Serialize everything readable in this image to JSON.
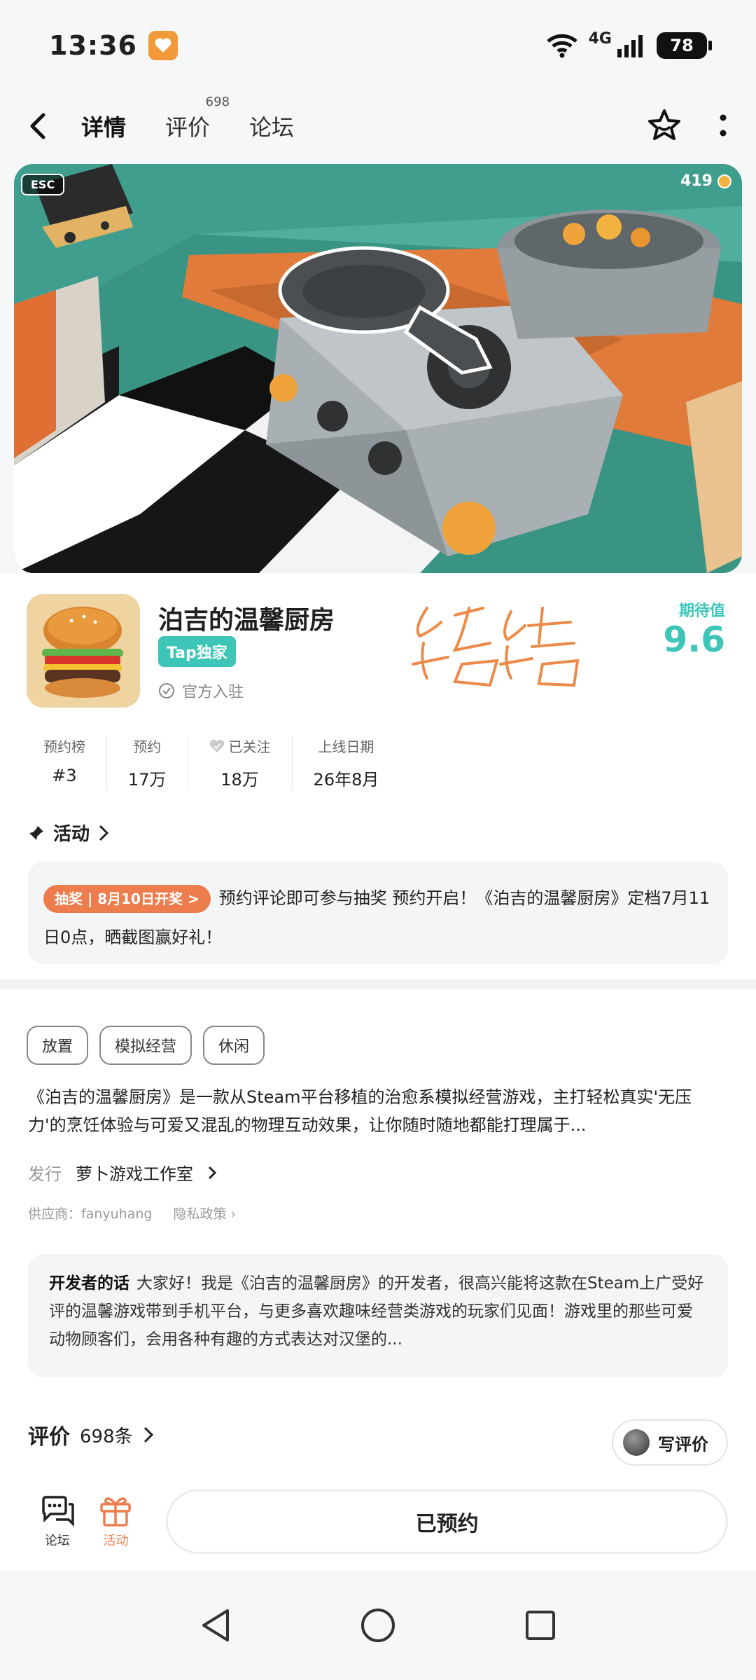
{
  "status": {
    "time": "13:36",
    "network": "4G",
    "battery": "78"
  },
  "nav": {
    "tabs": [
      {
        "label": "详情"
      },
      {
        "label": "评价",
        "count": "698"
      },
      {
        "label": "论坛"
      }
    ]
  },
  "hero": {
    "esc": "ESC",
    "counter": "419"
  },
  "game": {
    "title": "泊吉的温馨厨房",
    "badge": "Tap独家",
    "official": "官方入驻",
    "expect_label": "期待值",
    "expect_score": "9.6"
  },
  "stats": [
    {
      "label": "预约榜",
      "value": "#3"
    },
    {
      "label": "预约",
      "value": "17万"
    },
    {
      "label": "已关注",
      "value": "18万"
    },
    {
      "label": "上线日期",
      "value": "26年8月"
    }
  ],
  "activity": {
    "title": "活动",
    "tag": "抽奖 | 8月10日开奖 >",
    "text": "预约评论即可参与抽奖 预约开启！《泊吉的温馨厨房》定档7月11日0点，晒截图赢好礼！"
  },
  "tags": [
    "放置",
    "模拟经营",
    "休闲"
  ],
  "description": "《泊吉的温馨厨房》是一款从Steam平台移植的治愈系模拟经营游戏，主打轻松真实'无压力'的烹饪体验与可爱又混乱的物理互动效果，让你随时随地都能打理属于...",
  "publisher": {
    "label": "发行",
    "name": "萝卜游戏工作室"
  },
  "supplier": {
    "text": "供应商：fanyuhang",
    "privacy": "隐私政策"
  },
  "developer": {
    "label": "开发者的话",
    "text": "大家好！我是《泊吉的温馨厨房》的开发者，很高兴能将这款在Steam上广受好评的温馨游戏带到手机平台，与更多喜欢趣味经营类游戏的玩家们见面！游戏里的那些可爱动物顾客们，会用各种有趣的方式表达对汉堡的..."
  },
  "reviews": {
    "title": "评价",
    "count": "698条",
    "write": "写评价"
  },
  "bottom": {
    "forum": "论坛",
    "activity": "活动",
    "reserved": "已预约"
  }
}
